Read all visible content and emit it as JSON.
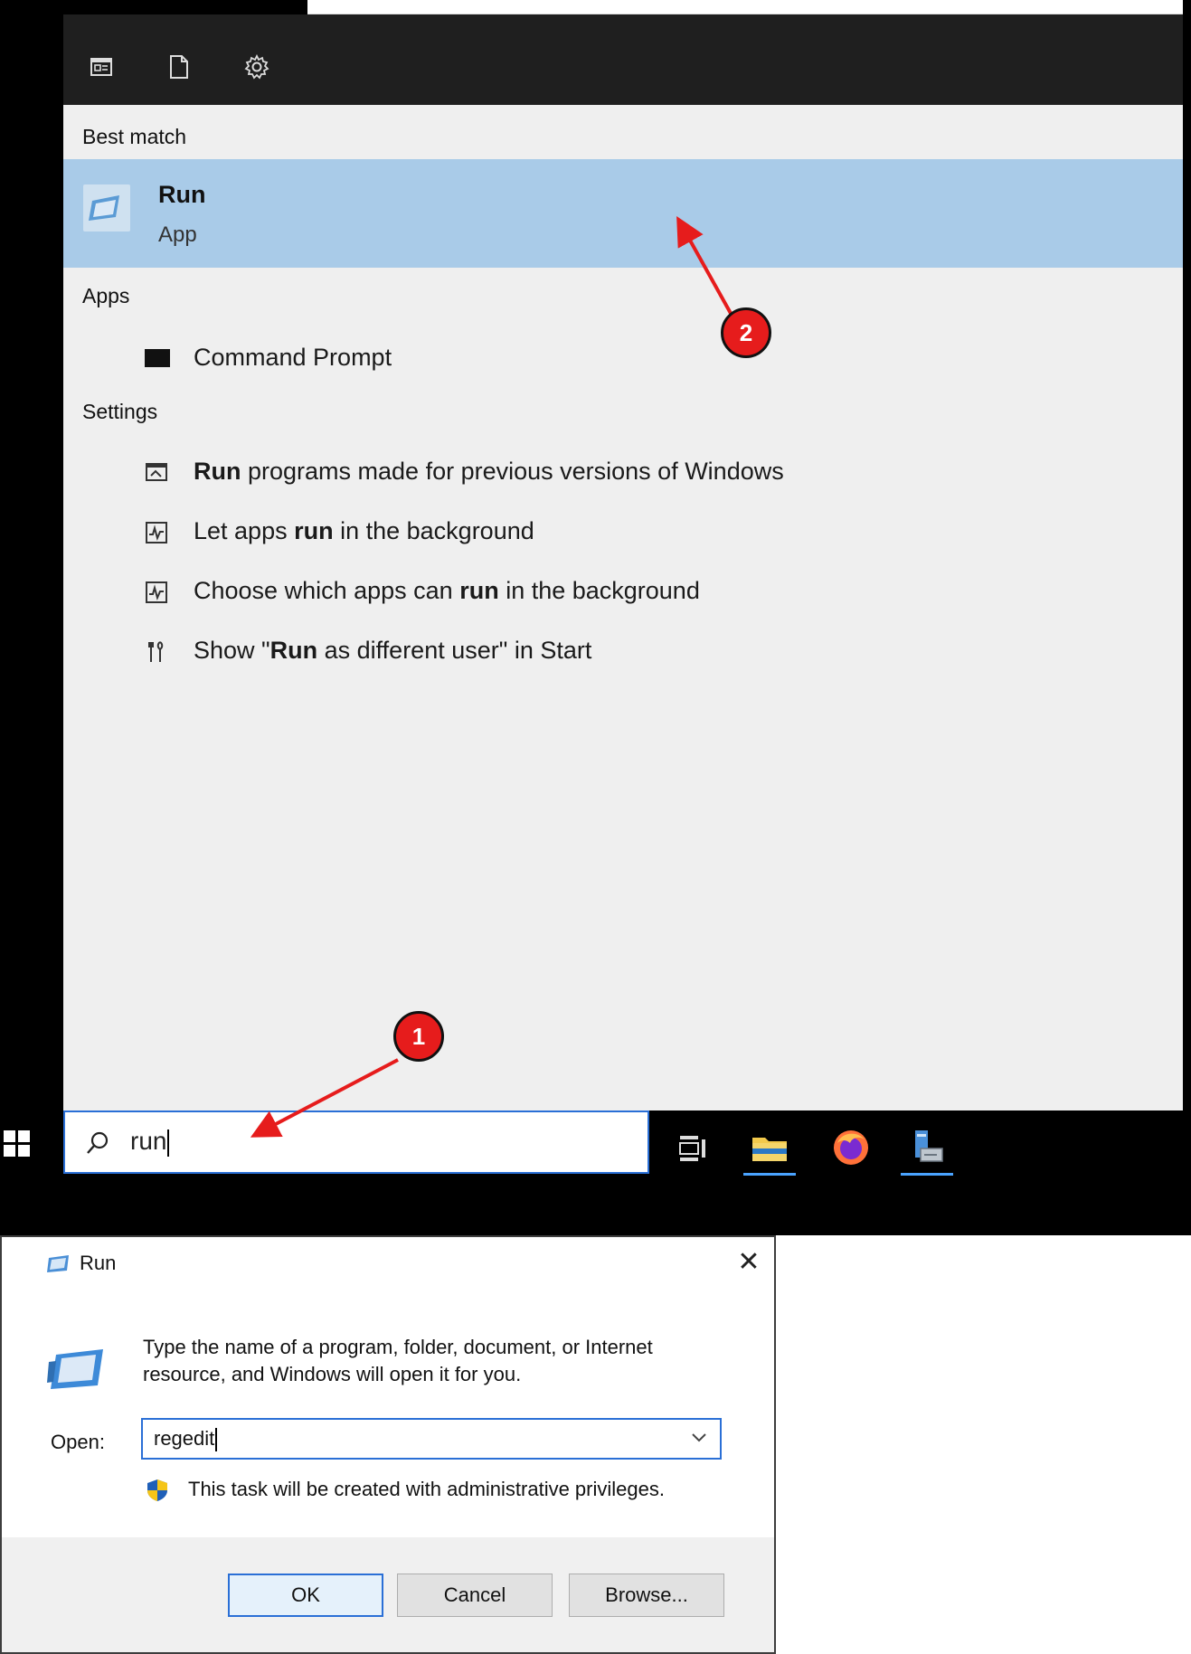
{
  "start_menu": {
    "header_icons": [
      "apps-view-icon",
      "document-icon",
      "gear-icon"
    ],
    "best_match": {
      "heading": "Best match",
      "app_title": "Run",
      "app_subtitle": "App"
    },
    "apps": {
      "heading": "Apps",
      "items": [
        {
          "label": "Command Prompt",
          "icon": "command-prompt-icon"
        }
      ]
    },
    "settings": {
      "heading": "Settings",
      "items": [
        {
          "bold": "Run",
          "rest": " programs made for previous versions of Windows",
          "icon": "compatibility-icon"
        },
        {
          "pre": "Let apps ",
          "bold": "run",
          "post": " in the background",
          "icon": "activity-icon"
        },
        {
          "pre": "Choose which apps can ",
          "bold": "run",
          "post": " in the background",
          "icon": "activity-icon"
        },
        {
          "pre": "Show \"",
          "bold": "Run",
          "post": " as different user\" in Start",
          "icon": "tools-icon"
        }
      ]
    }
  },
  "taskbar": {
    "search_value": "run",
    "icons": [
      "task-view-icon",
      "file-explorer-icon",
      "firefox-icon",
      "server-manager-icon"
    ]
  },
  "run_dialog": {
    "title": "Run",
    "close_glyph": "✕",
    "description": "Type the name of a program, folder, document, or Internet resource, and Windows will open it for you.",
    "open_label": "Open:",
    "open_value": "regedit",
    "admin_note": "This task will be created with administrative privileges.",
    "ok_label": "OK",
    "cancel_label": "Cancel",
    "browse_label": "Browse..."
  },
  "annotations": {
    "badge_1": "1",
    "badge_2": "2",
    "accent_color": "#e61c1c"
  }
}
